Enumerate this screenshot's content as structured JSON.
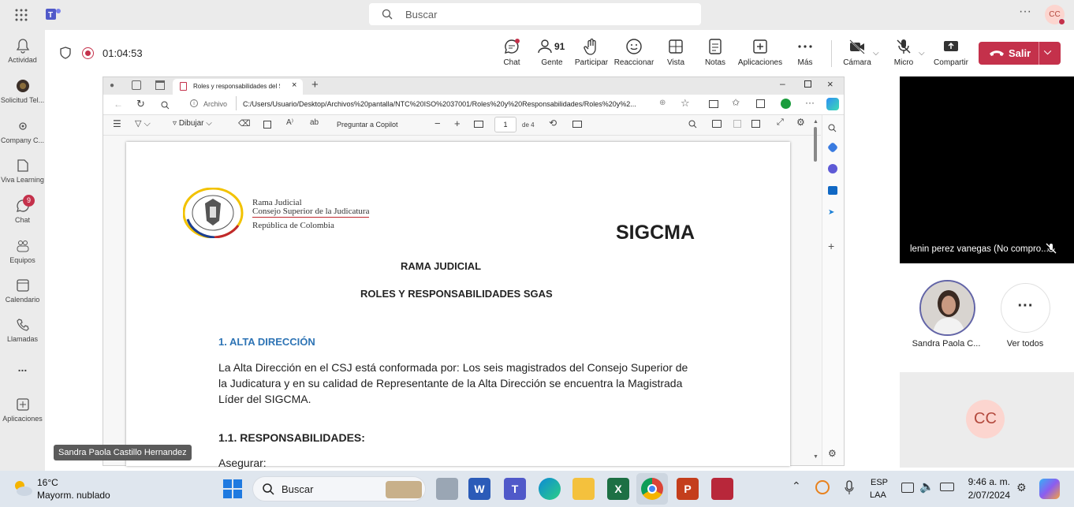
{
  "search": {
    "placeholder": "Buscar"
  },
  "profile": {
    "initials": "CC"
  },
  "rail": [
    {
      "label": "Actividad"
    },
    {
      "label": "Solicitud Tel..."
    },
    {
      "label": "Company C..."
    },
    {
      "label": "Viva Learning"
    },
    {
      "label": "Chat",
      "badge": "9"
    },
    {
      "label": "Equipos"
    },
    {
      "label": "Calendario"
    },
    {
      "label": "Llamadas"
    },
    {
      "label": "..."
    },
    {
      "label": "Aplicaciones"
    }
  ],
  "meeting": {
    "timer": "01:04:53"
  },
  "toolbar": {
    "chat": "Chat",
    "people_count": "91",
    "people": "Gente",
    "raise": "Participar",
    "react": "Reaccionar",
    "view": "Vista",
    "notes": "Notas",
    "apps": "Aplicaciones",
    "more": "Más",
    "camera": "Cámara",
    "mic": "Micro",
    "share": "Compartir",
    "leave": "Salir"
  },
  "browser": {
    "tab_title": "Roles y responsabilidades del SG",
    "file_label": "Archivo",
    "url": "C:/Users/Usuario/Desktop/Archivos%20pantalla/NTC%20ISO%2037001/Roles%20y%20Responsabilidades/Roles%20y%2...",
    "draw": "Dibujar",
    "copilot": "Preguntar a Copilot",
    "page_num": "1",
    "page_total": "de 4"
  },
  "document": {
    "logo_line1": "Rama Judicial",
    "logo_line2": "Consejo Superior de la Judicatura",
    "logo_line3": "República de Colombia",
    "sigcma": "SIGCMA",
    "title1": "RAMA JUDICIAL",
    "title2": "ROLES Y RESPONSABILIDADES SGAS",
    "section1": "1. ALTA DIRECCIÓN",
    "paragraph": "La Alta Dirección en el CSJ está conformada por: Los seis magistrados del Consejo Superior de la Judicatura y en su calidad de Representante de la Alta Dirección se encuentra la Magistrada Líder del SIGCMA.",
    "section2": "1.1. RESPONSABILIDADES:",
    "asegurar": "Asegurar:"
  },
  "participants": {
    "video_name": "lenin perez vanegas (No compro...",
    "p1_name": "Sandra Paola C...",
    "see_all": "Ver todos",
    "cc_initials": "CC",
    "presenter_tag": "Sandra Paola Castillo Hernandez"
  },
  "taskbar": {
    "temp": "16°C",
    "weather": "Mayorm. nublado",
    "search": "Buscar",
    "lang1": "ESP",
    "lang2": "LAA",
    "time": "9:46 a. m.",
    "date": "2/07/2024"
  },
  "colors": {
    "leave": "#c4314b",
    "accent": "#5b5fc7",
    "heading_blue": "#2e74b5"
  }
}
